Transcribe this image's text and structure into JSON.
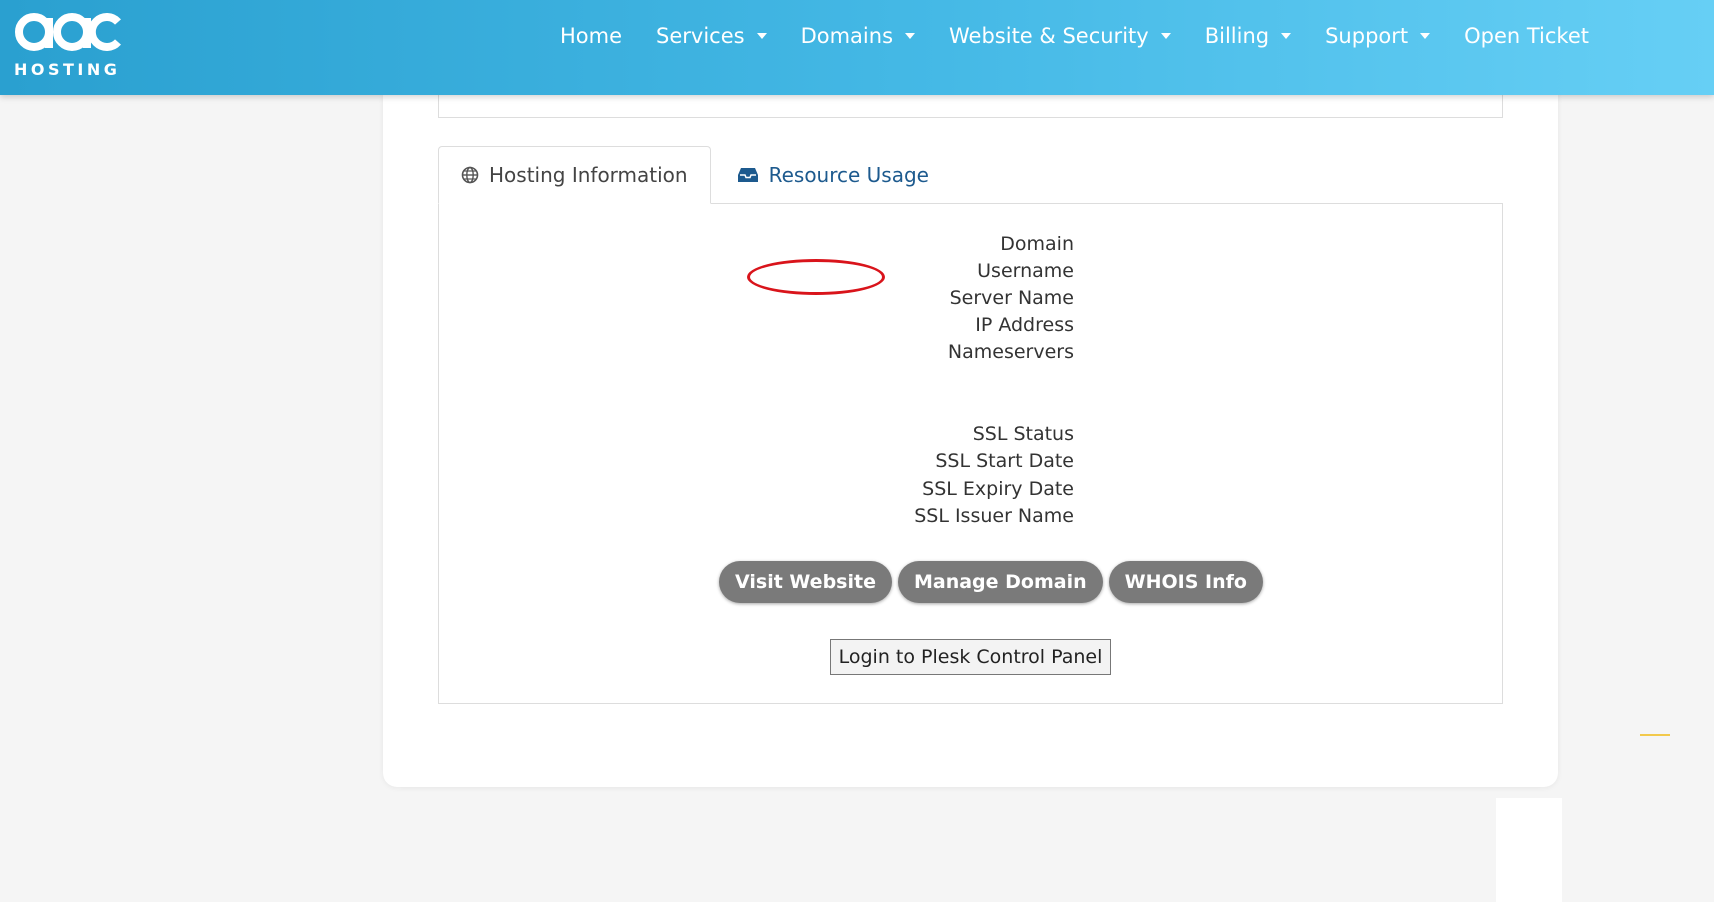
{
  "brand": {
    "logo_text": "HOSTING"
  },
  "nav": {
    "items": [
      {
        "label": "Home",
        "dropdown": false
      },
      {
        "label": "Services",
        "dropdown": true
      },
      {
        "label": "Domains",
        "dropdown": true
      },
      {
        "label": "Website & Security",
        "dropdown": true
      },
      {
        "label": "Billing",
        "dropdown": true
      },
      {
        "label": "Support",
        "dropdown": true
      },
      {
        "label": "Open Ticket",
        "dropdown": false
      }
    ]
  },
  "tabs": [
    {
      "label": "Hosting Information",
      "icon": "globe-icon",
      "active": true
    },
    {
      "label": "Resource Usage",
      "icon": "inbox-icon",
      "active": false
    }
  ],
  "info": {
    "domain": "Domain",
    "username": "Username",
    "server_name": "Server Name",
    "ip_address": "IP Address",
    "nameservers": "Nameservers",
    "ssl_status": "SSL Status",
    "ssl_start_date": "SSL Start Date",
    "ssl_expiry_date": "SSL Expiry Date",
    "ssl_issuer_name": "SSL Issuer Name"
  },
  "actions": {
    "visit_website": "Visit Website",
    "manage_domain": "Manage Domain",
    "whois_info": "WHOIS Info",
    "plesk_login": "Login to Plesk Control Panel"
  },
  "colors": {
    "header_start": "#2aa0d0",
    "header_end": "#66cff5",
    "link_blue": "#1d5a8e",
    "pill_gray": "#7a7a7a",
    "annotation_red": "#d9141b"
  }
}
